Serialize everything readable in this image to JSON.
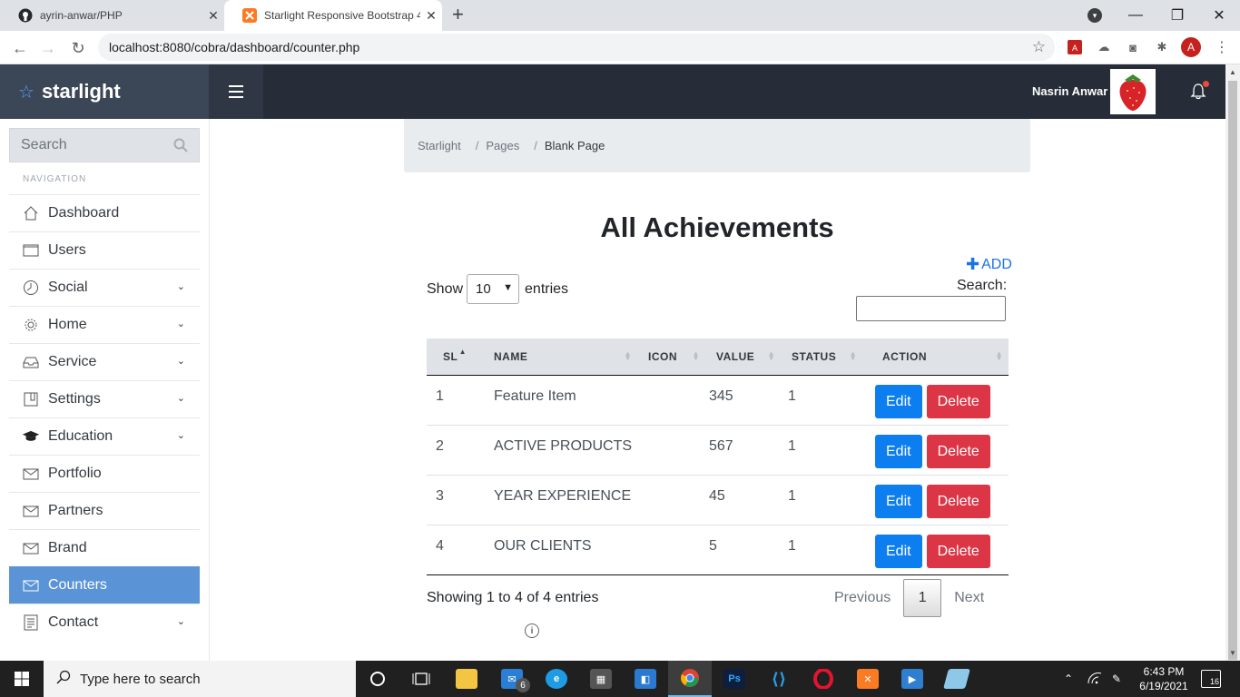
{
  "browser": {
    "tabs": [
      {
        "label": "ayrin-anwar/PHP",
        "icon": "github-icon",
        "active": false
      },
      {
        "label": "Starlight Responsive Bootstrap 4",
        "icon": "xampp-icon",
        "active": true
      }
    ],
    "url": "localhost:8080/cobra/dashboard/counter.php",
    "profile_initial": "A"
  },
  "header": {
    "brand": "starlight",
    "username": "Nasrin Anwar"
  },
  "sidebar": {
    "search_placeholder": "Search",
    "heading": "NAVIGATION",
    "items": [
      {
        "label": "Dashboard",
        "icon": "home-icon",
        "expandable": false
      },
      {
        "label": "Users",
        "icon": "window-icon",
        "expandable": false
      },
      {
        "label": "Social",
        "icon": "clock-icon",
        "expandable": true
      },
      {
        "label": "Home",
        "icon": "gear-icon",
        "expandable": true
      },
      {
        "label": "Service",
        "icon": "inbox-icon",
        "expandable": true
      },
      {
        "label": "Settings",
        "icon": "book-icon",
        "expandable": true
      },
      {
        "label": "Education",
        "icon": "graduation-cap-icon",
        "expandable": true
      },
      {
        "label": "Portfolio",
        "icon": "mail-icon",
        "expandable": false
      },
      {
        "label": "Partners",
        "icon": "mail-icon",
        "expandable": false
      },
      {
        "label": "Brand",
        "icon": "mail-icon",
        "expandable": false
      },
      {
        "label": "Counters",
        "icon": "mail-icon",
        "expandable": false,
        "active": true
      },
      {
        "label": "Contact",
        "icon": "document-icon",
        "expandable": true
      }
    ]
  },
  "breadcrumb": [
    "Starlight",
    "Pages",
    "Blank Page"
  ],
  "main": {
    "title": "All Achievements",
    "add_label": "ADD",
    "show_label": "Show",
    "page_length": "10",
    "entries_label": "entries",
    "search_label": "Search:",
    "search_value": "",
    "columns": [
      "SL",
      "NAME",
      "ICON",
      "VALUE",
      "STATUS",
      "ACTION"
    ],
    "rows": [
      {
        "sl": "1",
        "name": "Feature Item",
        "icon": "",
        "value": "345",
        "status": "1"
      },
      {
        "sl": "2",
        "name": "ACTIVE PRODUCTS",
        "icon": "",
        "value": "567",
        "status": "1"
      },
      {
        "sl": "3",
        "name": "YEAR EXPERIENCE",
        "icon": "",
        "value": "45",
        "status": "1"
      },
      {
        "sl": "4",
        "name": "OUR CLIENTS",
        "icon": "",
        "value": "5",
        "status": "1"
      }
    ],
    "edit_label": "Edit",
    "delete_label": "Delete",
    "info": "Showing 1 to 4 of 4 entries",
    "pager": {
      "previous": "Previous",
      "current": "1",
      "next": "Next"
    }
  },
  "taskbar": {
    "search_placeholder": "Type here to search",
    "mail_badge": "6",
    "time": "6:43 PM",
    "date": "6/19/2021",
    "notifications": "16"
  },
  "colors": {
    "brand_bg": "#3b4656",
    "topbar_bg": "#262d38",
    "active_nav": "#5b94d6",
    "edit_button": "#0d7ef0",
    "delete_button": "#dc3545"
  }
}
